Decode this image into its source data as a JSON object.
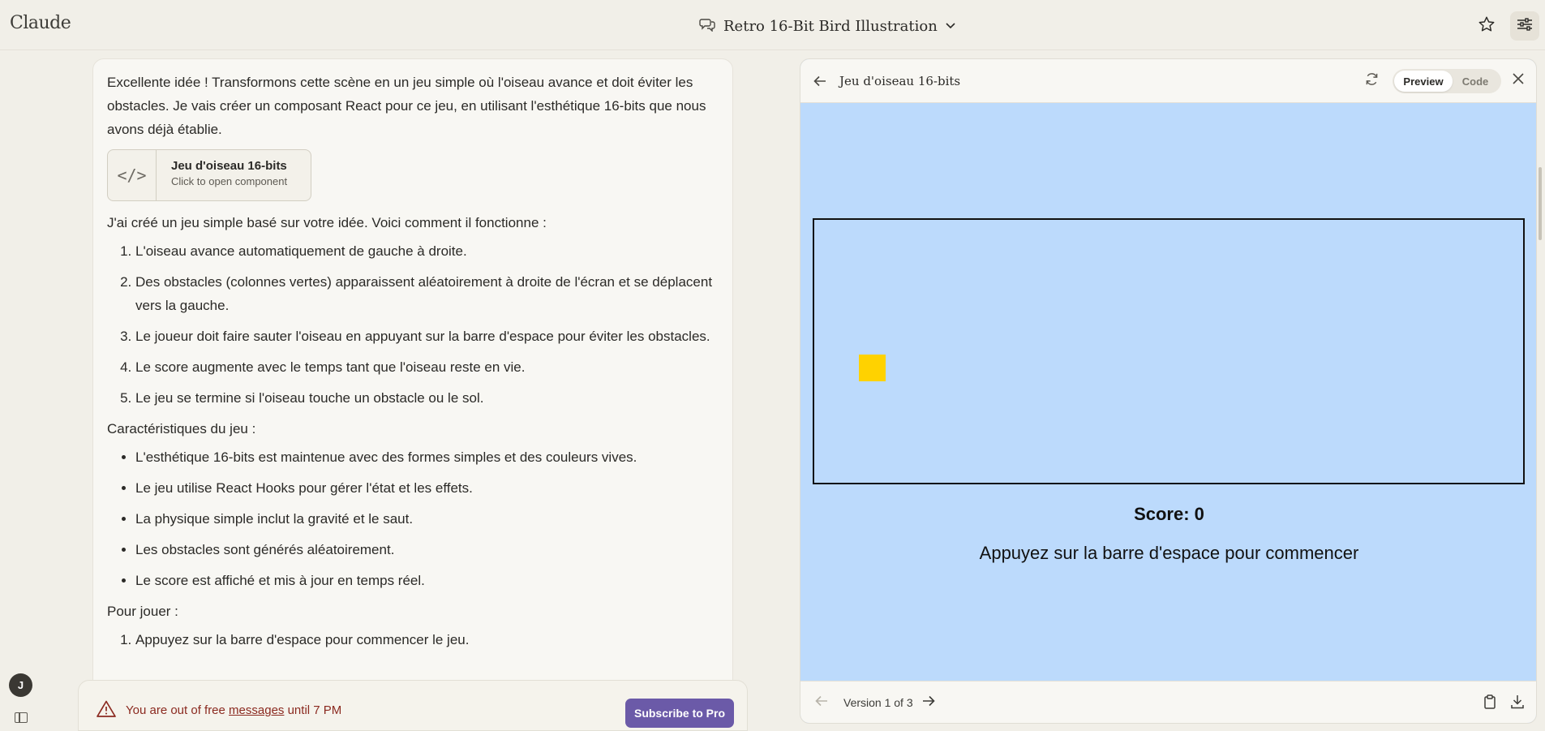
{
  "app": {
    "brand": "Claude"
  },
  "header": {
    "conversation_title": "Retro 16-Bit Bird Illustration"
  },
  "chat": {
    "intro": "Excellente idée ! Transformons cette scène en un jeu simple où l'oiseau avance et doit éviter les obstacles. Je vais créer un composant React pour ce jeu, en utilisant l'esthétique 16-bits que nous avons déjà établie.",
    "artifact_card": {
      "name": "Jeu d'oiseau 16-bits",
      "subtitle": "Click to open component",
      "icon": "</>"
    },
    "explain": "J'ai créé un jeu simple basé sur votre idée. Voici comment il fonctionne :",
    "steps": [
      "L'oiseau avance automatiquement de gauche à droite.",
      "Des obstacles (colonnes vertes) apparaissent aléatoirement à droite de l'écran et se déplacent vers la gauche.",
      "Le joueur doit faire sauter l'oiseau en appuyant sur la barre d'espace pour éviter les obstacles.",
      "Le score augmente avec le temps tant que l'oiseau reste en vie.",
      "Le jeu se termine si l'oiseau touche un obstacle ou le sol."
    ],
    "features_heading": "Caractéristiques du jeu :",
    "features": [
      "L'esthétique 16-bits est maintenue avec des formes simples et des couleurs vives.",
      "Le jeu utilise React Hooks pour gérer l'état et les effets.",
      "La physique simple inclut la gravité et le saut.",
      "Les obstacles sont générés aléatoirement.",
      "Le score est affiché et mis à jour en temps réel."
    ],
    "play_heading": "Pour jouer :",
    "play_steps": [
      "Appuyez sur la barre d'espace pour commencer le jeu."
    ]
  },
  "limit_bar": {
    "text_before": "You are out of free ",
    "link": "messages",
    "text_after": " until 7 PM",
    "button": "Subscribe to Pro"
  },
  "user": {
    "initial": "J"
  },
  "artifact": {
    "title": "Jeu d'oiseau 16-bits",
    "tabs": {
      "preview": "Preview",
      "code": "Code"
    },
    "score": "Score: 0",
    "hint": "Appuyez sur la barre d'espace pour commencer",
    "version": "Version 1 of 3",
    "colors": {
      "sky": "#bcdafc",
      "bird": "#ffd200"
    }
  }
}
